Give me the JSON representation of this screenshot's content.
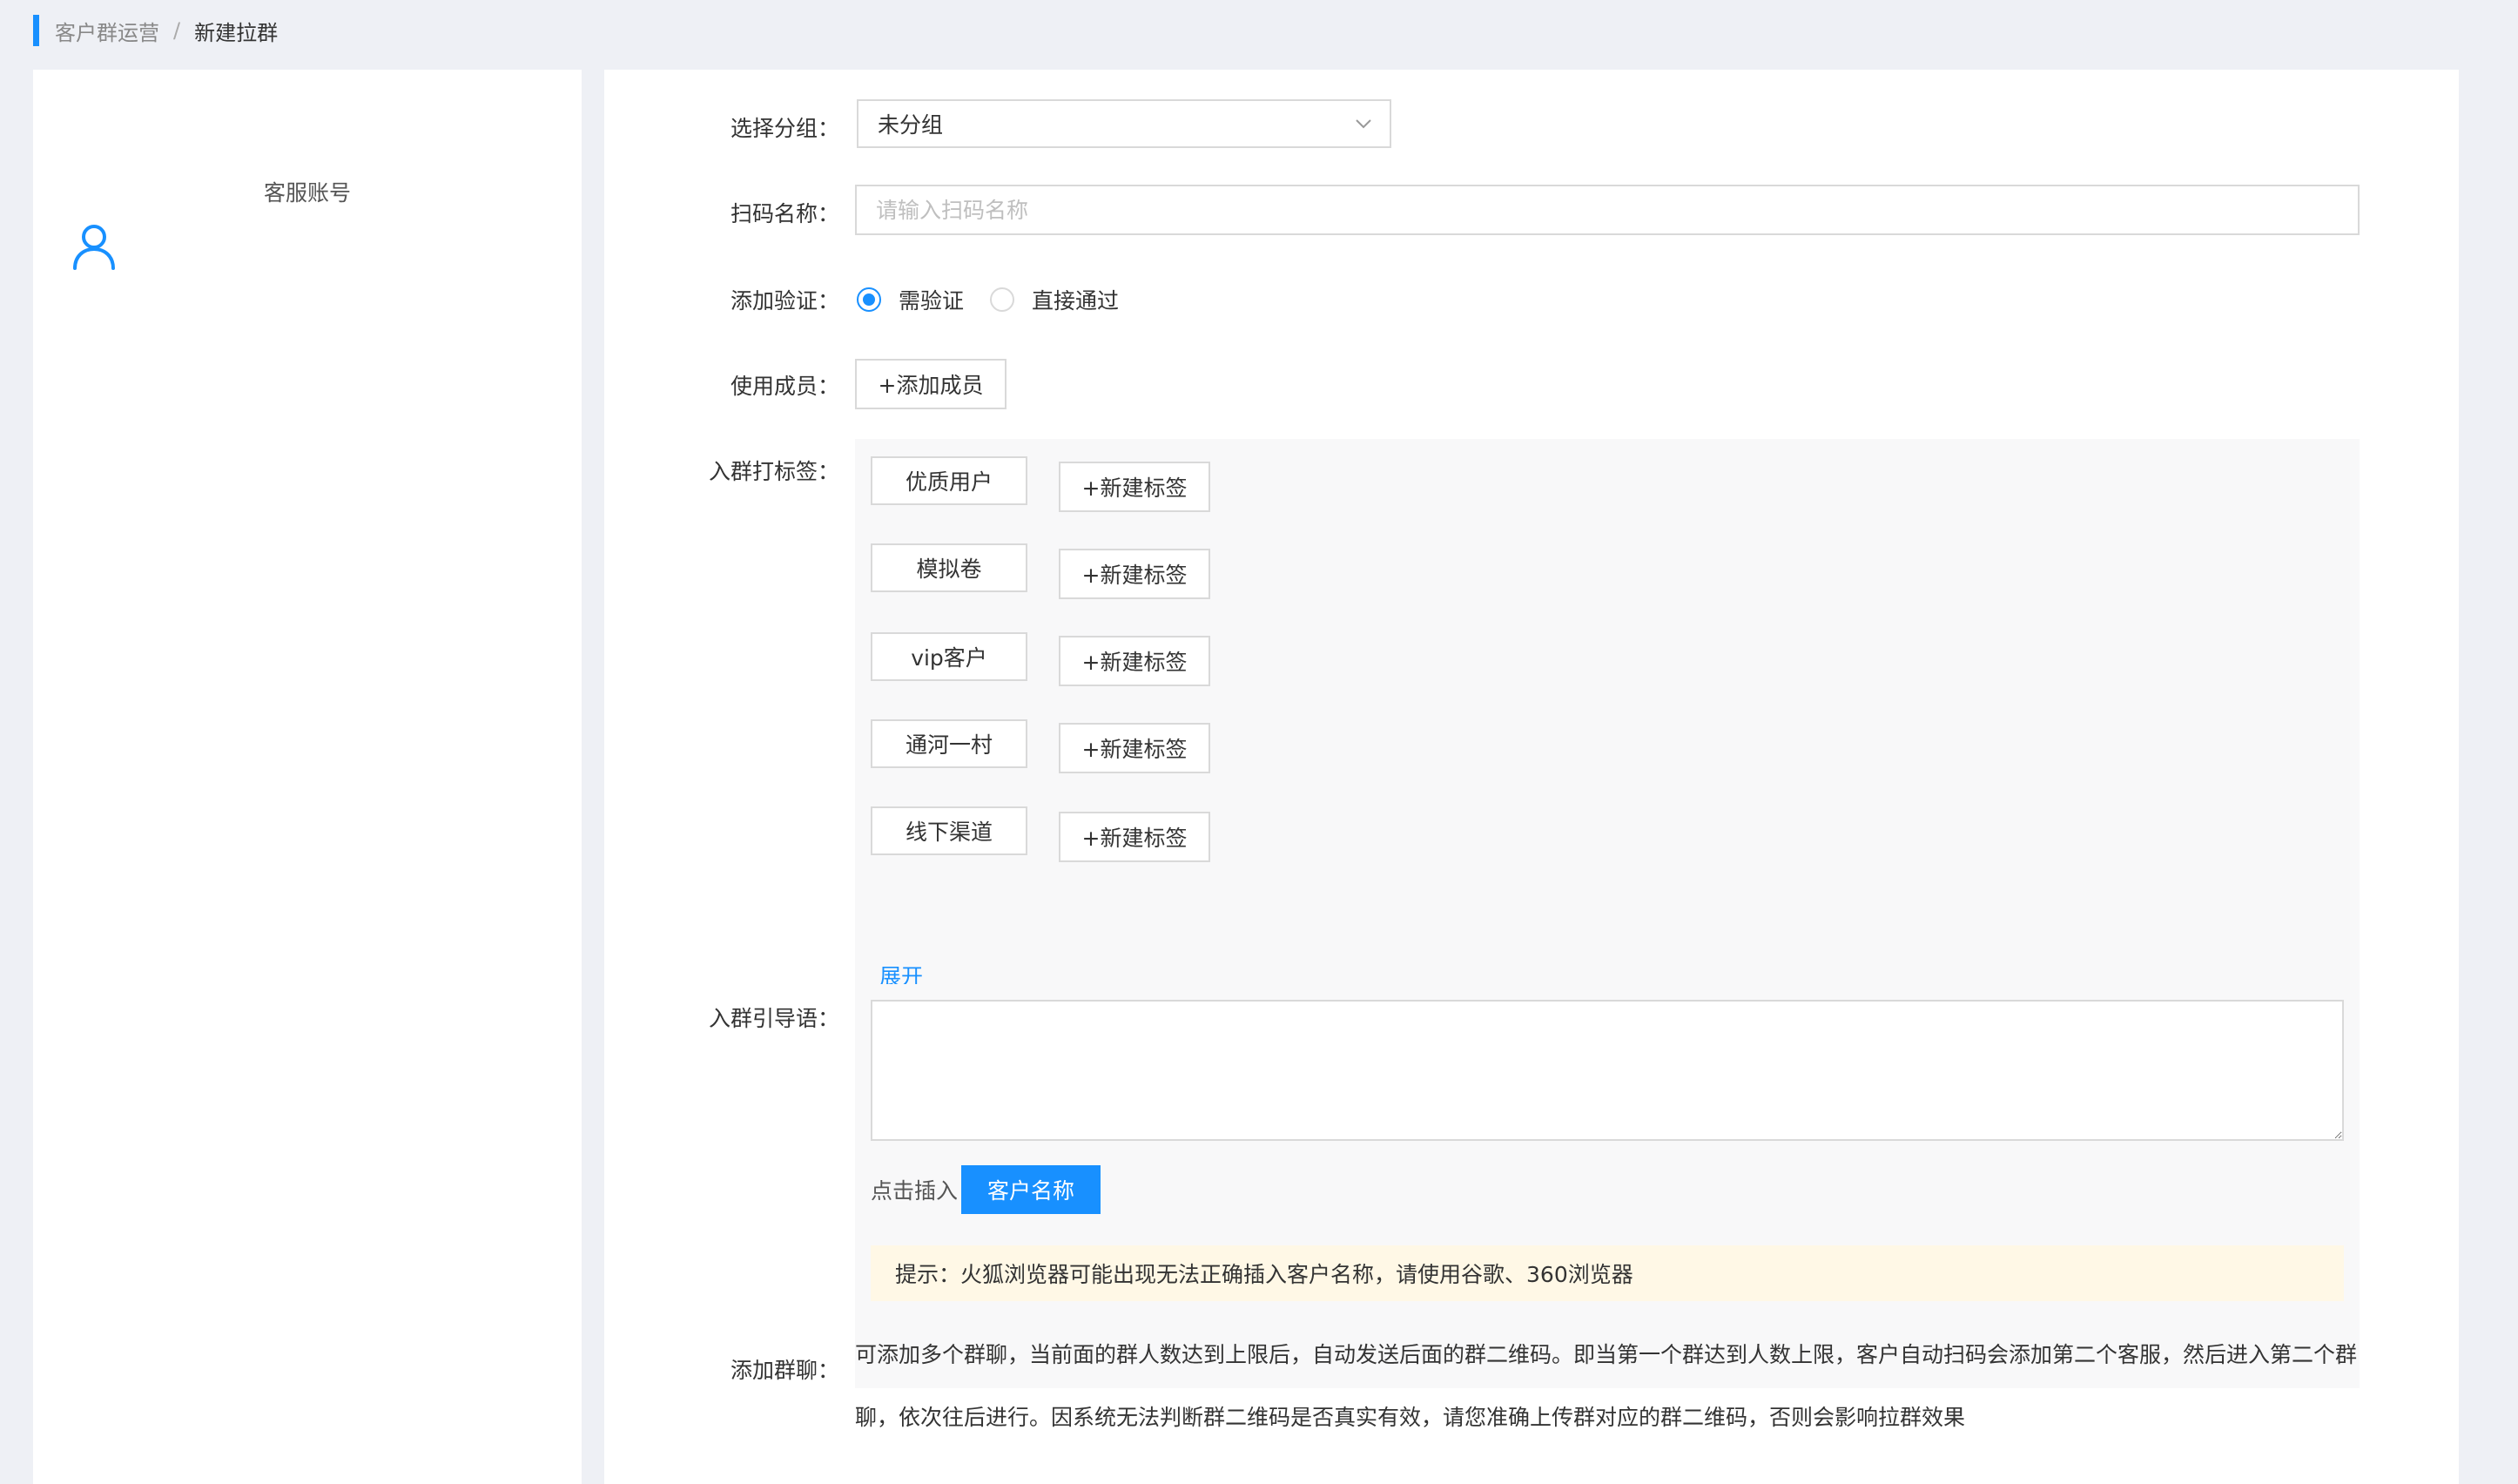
{
  "breadcrumb": {
    "parent": "客户群运营",
    "separator": "/",
    "current": "新建拉群"
  },
  "sidebar": {
    "title": "客服账号",
    "icon": "user-icon"
  },
  "form": {
    "group": {
      "label": "选择分组：",
      "value": "未分组"
    },
    "scan_name": {
      "label": "扫码名称：",
      "placeholder": "请输入扫码名称",
      "value": ""
    },
    "verify": {
      "label": "添加验证：",
      "options": [
        "需验证",
        "直接通过"
      ],
      "selected": "需验证"
    },
    "members": {
      "label": "使用成员：",
      "add_button": "+添加成员"
    },
    "tags": {
      "label": "入群打标签：",
      "items": [
        "优质用户",
        "模拟卷",
        "vip客户",
        "通河一村",
        "线下渠道"
      ],
      "new_tag_label": "+新建标签",
      "expand_label": "展开"
    },
    "guide": {
      "label": "入群引导语：",
      "value": "",
      "insert_label": "点击插入",
      "insert_button": "客户名称",
      "tip": "提示：火狐浏览器可能出现无法正确插入客户名称，请使用谷歌、360浏览器"
    },
    "group_chat": {
      "label": "添加群聊：",
      "description": "可添加多个群聊，当前面的群人数达到上限后，自动发送后面的群二维码。即当第一个群达到人数上限，客户自动扫码会添加第二个客服，然后进入第二个群聊，依次往后进行。因系统无法判断群二维码是否真实有效，请您准确上传群对应的群二维码，否则会影响拉群效果"
    }
  },
  "colors": {
    "accent": "#1890ff",
    "background": "#eef0f5",
    "tag_area": "#f8f8f9",
    "tip_background": "#fff8e6"
  }
}
